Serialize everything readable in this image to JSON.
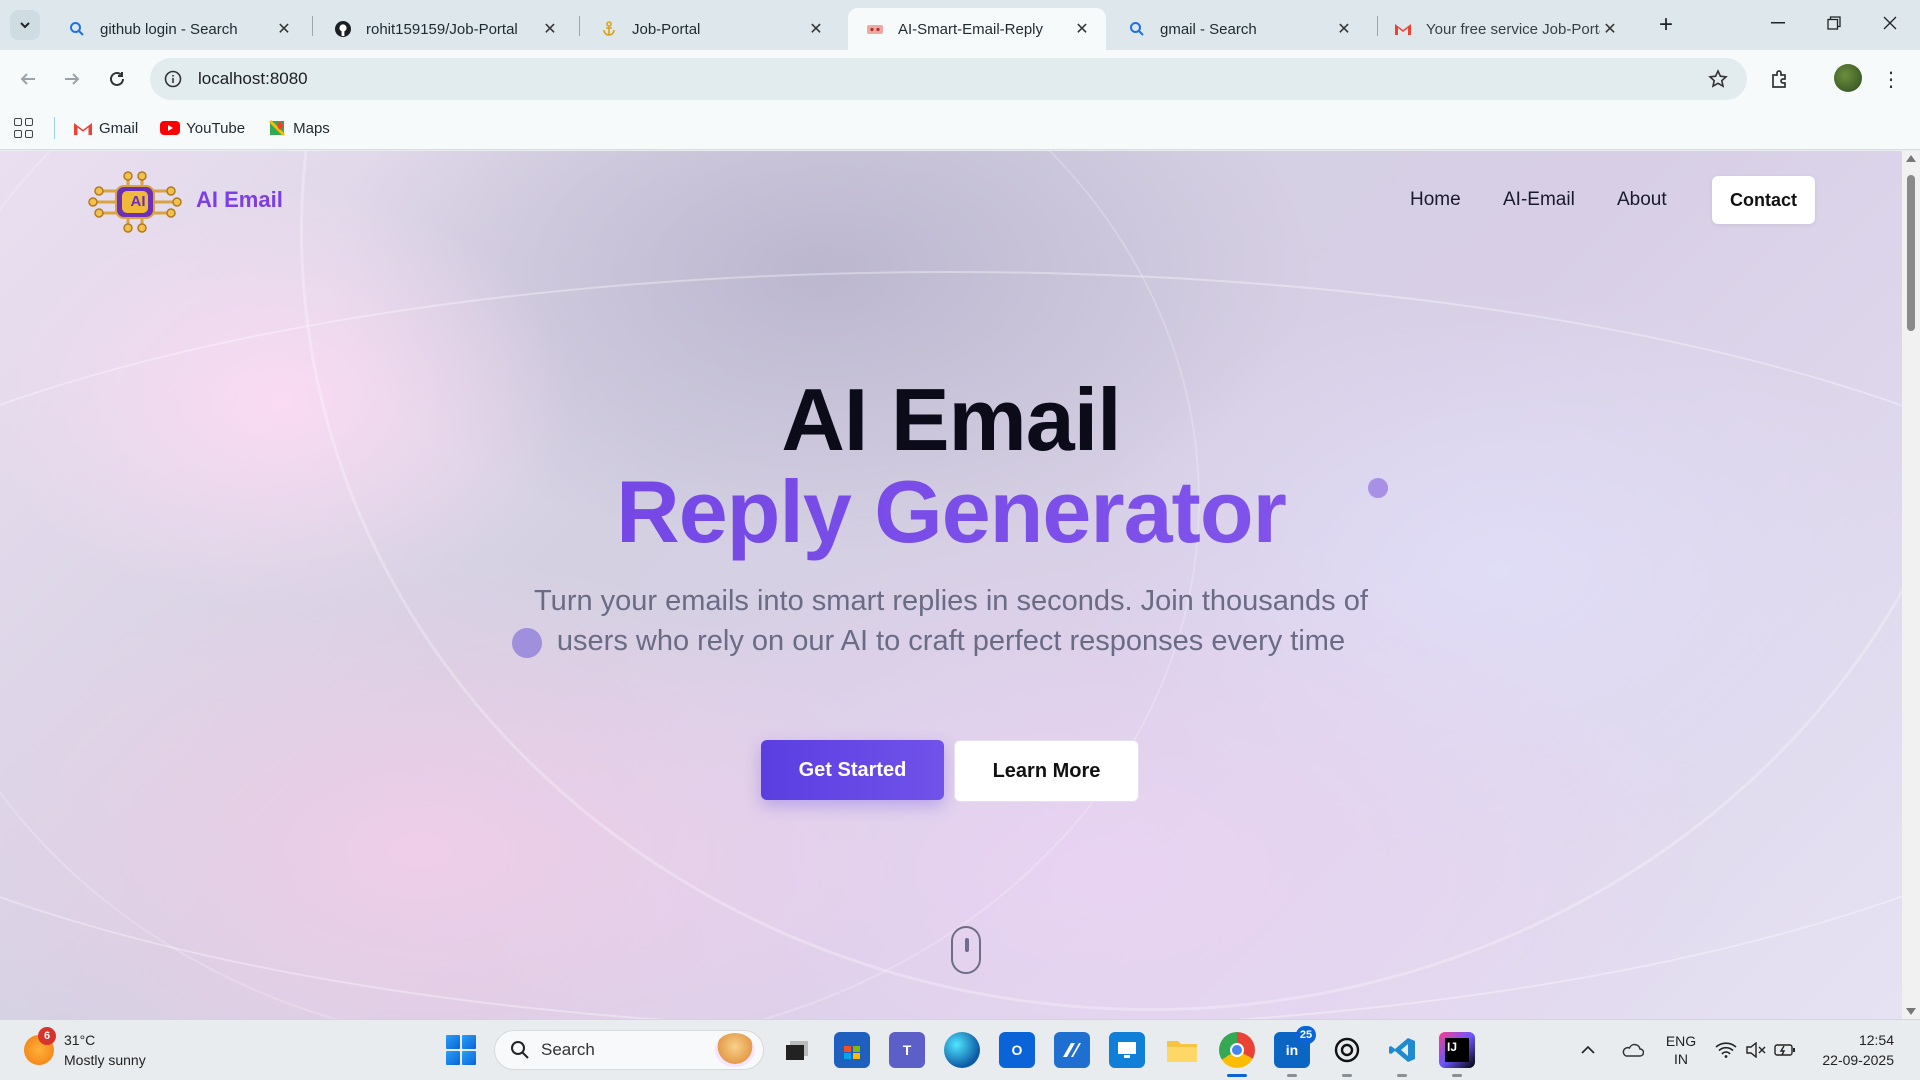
{
  "browser": {
    "tabs": [
      {
        "title": "github login - Search",
        "icon": "search-icon",
        "active": false
      },
      {
        "title": "rohit159159/Job-Portal",
        "icon": "github-icon",
        "active": false
      },
      {
        "title": "Job-Portal",
        "icon": "anchor-icon",
        "active": false
      },
      {
        "title": "AI-Smart-Email-Reply",
        "icon": "page-icon",
        "active": true
      },
      {
        "title": "gmail - Search",
        "icon": "search-icon",
        "active": false
      },
      {
        "title": "Your free service Job-Porta",
        "icon": "gmail-icon",
        "active": false
      }
    ],
    "url": "localhost:8080",
    "bookmarks": [
      {
        "label": "Gmail",
        "icon": "gmail-icon"
      },
      {
        "label": "YouTube",
        "icon": "youtube-icon"
      },
      {
        "label": "Maps",
        "icon": "maps-icon"
      }
    ]
  },
  "page": {
    "brand": "AI Email",
    "logo_text": "AI",
    "nav": {
      "home": "Home",
      "ai_email": "AI-Email",
      "about": "About",
      "contact": "Contact"
    },
    "hero": {
      "title_line1": "AI Email",
      "title_line2": "Reply Generator",
      "subtitle": "Turn your emails into smart replies in seconds. Join thousands of users who rely on our AI to craft perfect responses every time",
      "primary_cta": "Get Started",
      "secondary_cta": "Learn More"
    },
    "colors": {
      "brand": "#7b3fe4",
      "primary_button": "#5a3ee0",
      "title_accent": "#7147e8"
    }
  },
  "taskbar": {
    "weather": {
      "temp": "31°C",
      "condition": "Mostly sunny",
      "badge": "6"
    },
    "search_label": "Search",
    "linkedin_count": "25",
    "lang_line1": "ENG",
    "lang_line2": "IN",
    "time": "12:54",
    "date": "22-09-2025"
  }
}
